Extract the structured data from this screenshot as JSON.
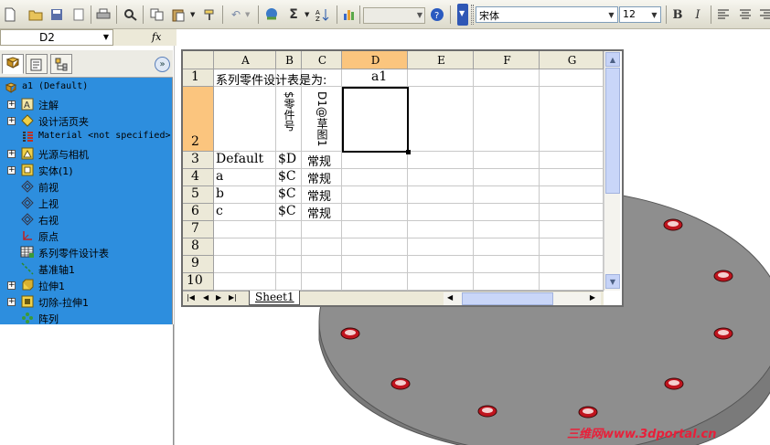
{
  "toolbar": {
    "font_name": "宋体",
    "font_size": "12",
    "bold": "B",
    "italic": "I"
  },
  "formula_bar": {
    "name_box": "D2",
    "fx": "fx"
  },
  "panel": {
    "collapse": "»",
    "tree": [
      {
        "label": "a1  (Default)",
        "mono": true,
        "expander": "",
        "icon": "part-icon"
      },
      {
        "label": "注解",
        "expander": "+",
        "icon": "annotation-icon"
      },
      {
        "label": "设计活页夹",
        "expander": "+",
        "icon": "design-binder-icon"
      },
      {
        "label": "Material <not specified>",
        "mono": true,
        "expander": "",
        "icon": "material-icon"
      },
      {
        "label": "光源与相机",
        "expander": "+",
        "icon": "lights-cameras-icon"
      },
      {
        "label": "实体(1)",
        "expander": "+",
        "icon": "solid-bodies-icon"
      },
      {
        "label": "前视",
        "expander": "",
        "icon": "plane-icon"
      },
      {
        "label": "上视",
        "expander": "",
        "icon": "plane-icon"
      },
      {
        "label": "右视",
        "expander": "",
        "icon": "plane-icon"
      },
      {
        "label": "原点",
        "expander": "",
        "icon": "origin-icon"
      },
      {
        "label": "系列零件设计表",
        "expander": "",
        "icon": "design-table-icon"
      },
      {
        "label": "基准轴1",
        "expander": "",
        "icon": "axis-icon"
      },
      {
        "label": "拉伸1",
        "expander": "+",
        "icon": "extrude-icon"
      },
      {
        "label": "切除-拉伸1",
        "expander": "+",
        "icon": "cut-extrude-icon"
      },
      {
        "label": "阵列",
        "expander": "",
        "icon": "pattern-icon"
      }
    ]
  },
  "sheet": {
    "columns": [
      "A",
      "B",
      "C",
      "D",
      "E",
      "F",
      "G"
    ],
    "rows": [
      "1",
      "2",
      "3",
      "4",
      "5",
      "6",
      "7",
      "8",
      "9",
      "10"
    ],
    "active_column": "D",
    "active_row": "2",
    "r1_a": "系列零件设计表是为:",
    "r1_d": "a1",
    "r2_b": "$零件号",
    "r2_c": "D1@草图1",
    "r3": [
      "Default",
      "$D",
      "常规"
    ],
    "r4": [
      "a",
      "$C",
      "常规"
    ],
    "r5": [
      "b",
      "$C",
      "常规"
    ],
    "r6": [
      "c",
      "$C",
      "常规"
    ],
    "tab": "Sheet1"
  },
  "watermark": "三维网www.3dportal.cn",
  "colors": {
    "tree_bg": "#2d8ede",
    "header_selected": "#fbc57e",
    "plate": "#8e8e8e",
    "hole": "#c0141e"
  }
}
